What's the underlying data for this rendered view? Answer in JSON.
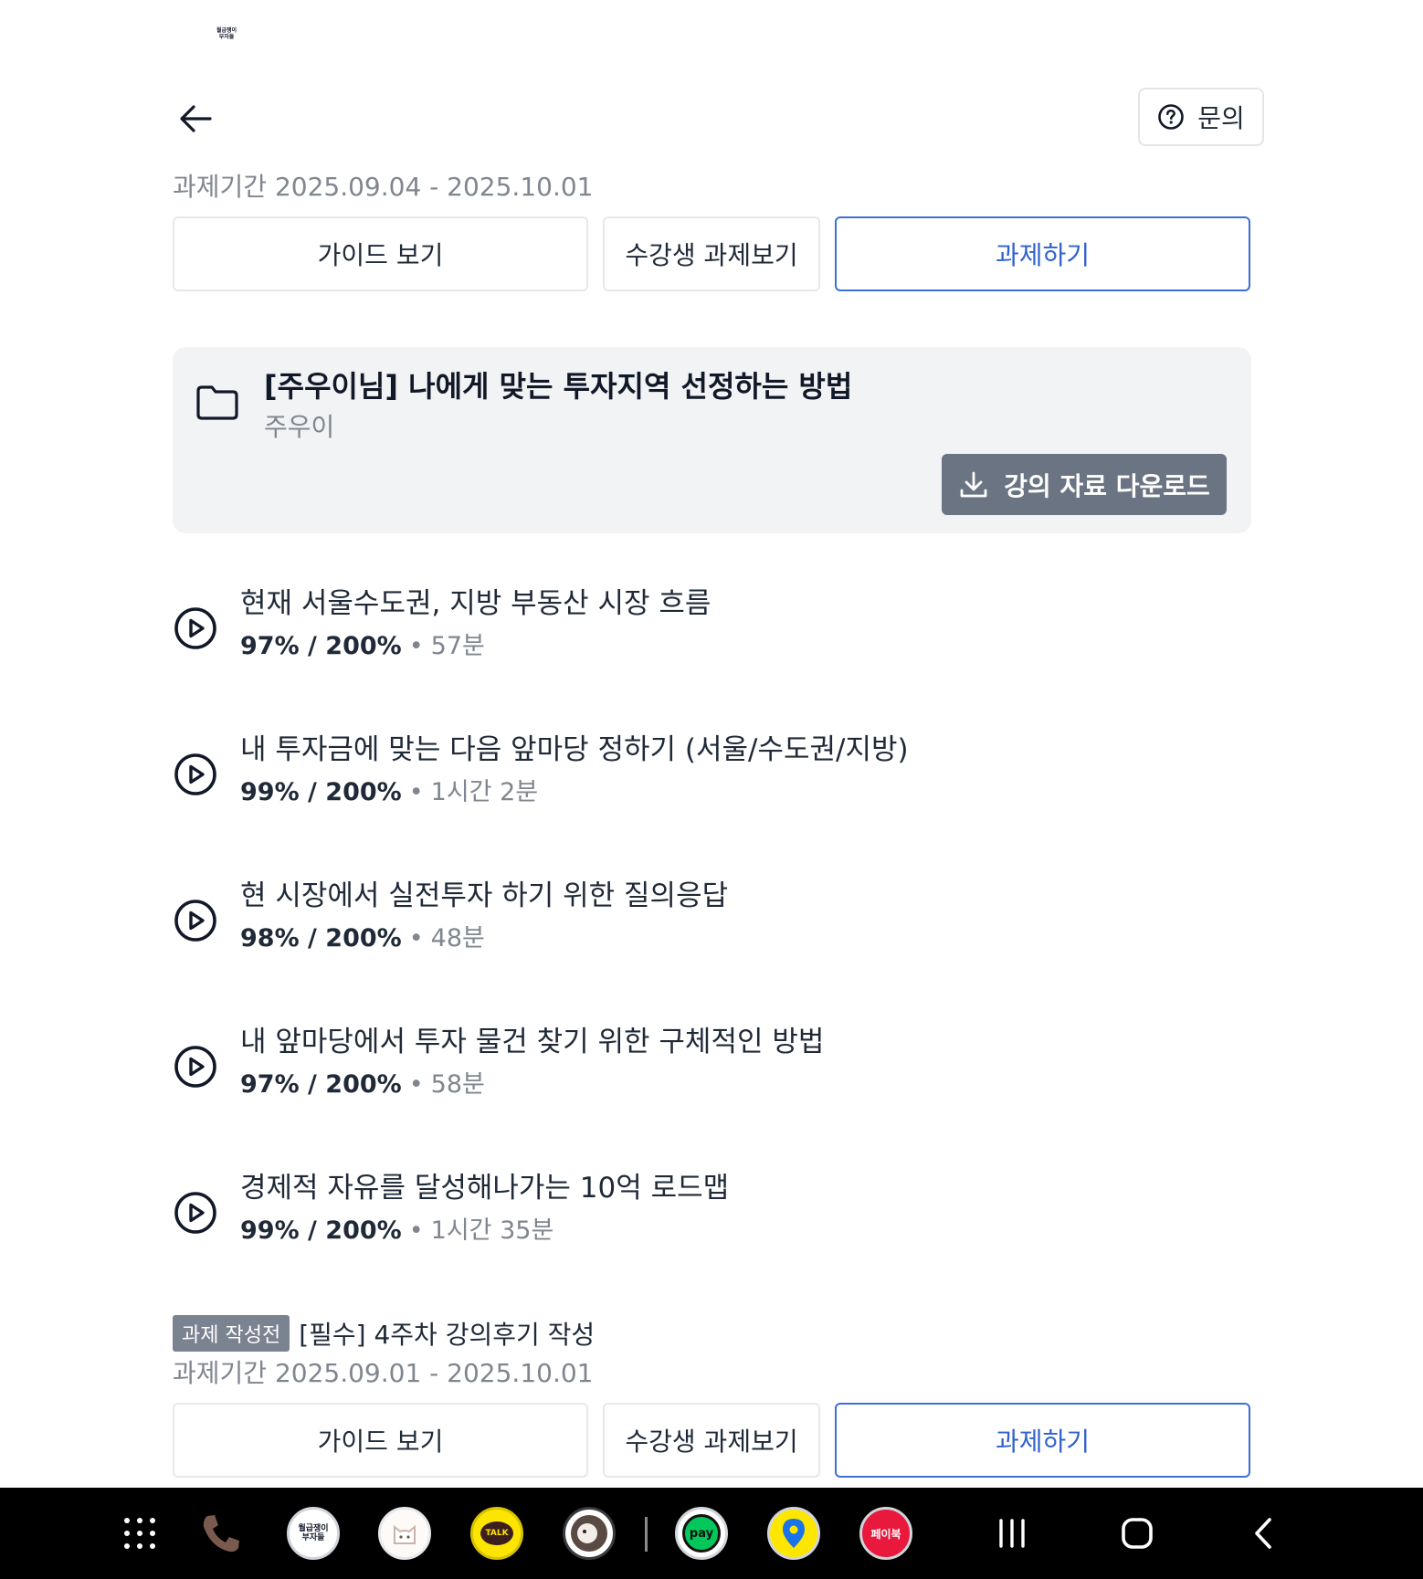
{
  "logo": {
    "line1": "월급쟁이",
    "line2": "부자들"
  },
  "header": {
    "inquiry_label": "문의"
  },
  "assignment1": {
    "period": "과제기간 2025.09.04 - 2025.10.01",
    "guide_label": "가이드 보기",
    "peer_label": "수강생 과제보기",
    "task_label": "과제하기"
  },
  "course": {
    "title": "[주우이님] 나에게 맞는 투자지역 선정하는 방법",
    "author": "주우이",
    "download_label": "강의 자료 다운로드"
  },
  "lectures": [
    {
      "title": "현재 서울수도권, 지방 부동산 시장 흐름",
      "progress": "97% / 200%",
      "dot": "•",
      "duration": "57분"
    },
    {
      "title": "내 투자금에 맞는 다음 앞마당 정하기 (서울/수도권/지방)",
      "progress": "99% / 200%",
      "dot": "•",
      "duration": "1시간 2분"
    },
    {
      "title": "현 시장에서 실전투자 하기 위한 질의응답",
      "progress": "98% / 200%",
      "dot": "•",
      "duration": "48분"
    },
    {
      "title": "내 앞마당에서 투자 물건 찾기 위한 구체적인 방법",
      "progress": "97% / 200%",
      "dot": "•",
      "duration": "58분"
    },
    {
      "title": "경제적 자유를 달성해나가는 10억 로드맵",
      "progress": "99% / 200%",
      "dot": "•",
      "duration": "1시간 35분"
    }
  ],
  "assignment2": {
    "badge": "과제 작성전",
    "title": "[필수] 4주차 강의후기 작성",
    "period": "과제기간 2025.09.01 - 2025.10.01",
    "guide_label": "가이드 보기",
    "peer_label": "수강생 과제보기",
    "task_label": "과제하기"
  },
  "navbar": {
    "apps": [
      {
        "name": "phone-icon"
      },
      {
        "name": "wolbu-app-icon",
        "label1": "월급쟁이",
        "label2": "부자들"
      },
      {
        "name": "cat-app-icon"
      },
      {
        "name": "kakaotalk-icon",
        "label": "TALK"
      },
      {
        "name": "dog-app-icon"
      },
      {
        "name": "naver-pay-icon",
        "label": "pay"
      },
      {
        "name": "map-pin-app-icon"
      },
      {
        "name": "paybook-icon",
        "label": "페이북"
      }
    ],
    "colors": {
      "bar": "#000000",
      "pay": "#03c75a",
      "talk": "#fee500",
      "paybook": "#e8193c"
    }
  }
}
